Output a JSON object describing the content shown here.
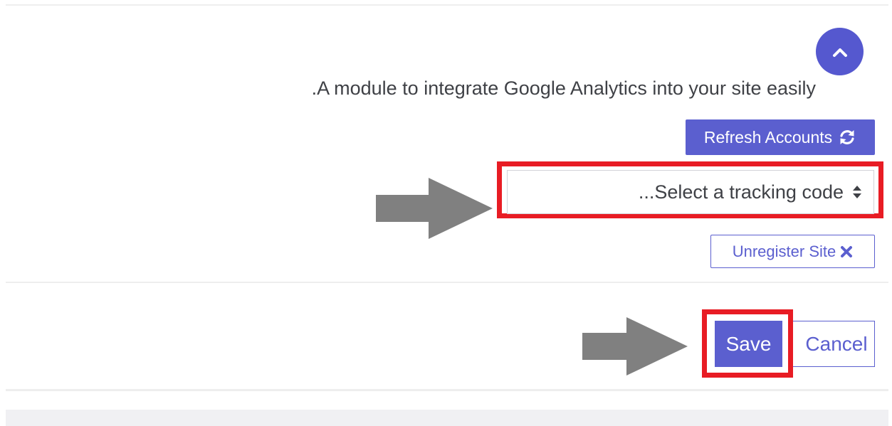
{
  "module": {
    "description": ".A module to integrate Google Analytics into your site easily",
    "collapse_icon": "chevron-up-icon"
  },
  "actions": {
    "refresh_label": "Refresh Accounts",
    "refresh_icon": "refresh-icon",
    "tracking_select": {
      "selected": "...Select a tracking code",
      "icon": "sort-arrows-icon"
    },
    "unregister_label": "Unregister Site",
    "unregister_icon": "close-icon"
  },
  "footer": {
    "save_label": "Save",
    "cancel_label": "Cancel"
  },
  "colors": {
    "primary": "#5b5fcf",
    "highlight": "#e81c24",
    "arrow": "#808080",
    "text": "#3f4146"
  }
}
